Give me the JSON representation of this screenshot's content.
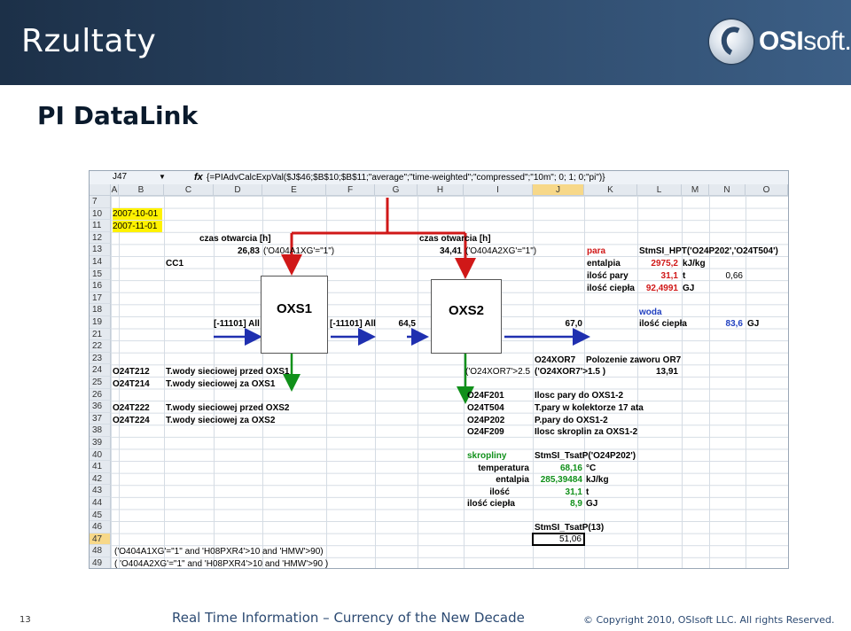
{
  "header": {
    "title": "Rzultaty",
    "logo_text_bold": "OSI",
    "logo_text_thin": "soft",
    "logo_reg": "."
  },
  "subtitle": "PI DataLink",
  "sheet": {
    "name_box": "J47",
    "fx": "fx",
    "formula": "{=PIAdvCalcExpVal($J$46;$B$10;$B$11;\"average\";\"time-weighted\";\"compressed\";\"10m\"; 0; 1; 0;\"pi\")}",
    "columns": [
      "A",
      "B",
      "C",
      "D",
      "E",
      "F",
      "G",
      "H",
      "I",
      "J",
      "K",
      "L",
      "M",
      "N",
      "O"
    ],
    "rows": [
      "7",
      "10",
      "11",
      "12",
      "13",
      "14",
      "15",
      "16",
      "17",
      "18",
      "19",
      "21",
      "22",
      "23",
      "24",
      "25",
      "26",
      "36",
      "37",
      "38",
      "39",
      "40",
      "41",
      "42",
      "43",
      "44",
      "45",
      "46",
      "47",
      "48",
      "49"
    ],
    "cells": {
      "b10": "2007-10-01",
      "b11": "2007-11-01",
      "czas1": "czas otwarcia [h]",
      "czas1_val": "26,83",
      "czas1_expr": "('O404A1XG'=\"1\")",
      "czas2": "czas otwarcia [h]",
      "czas2_val": "34,41",
      "czas2_expr": "('O404A2XG'=\"1\")",
      "cc1": "CC1",
      "para": "para",
      "stmsi_hpt": "StmSI_HPT('O24P202','O24T504')",
      "entalpia": "entalpia",
      "entalpia_val": "2975,2",
      "entalpia_unit": "kJ/kg",
      "ilosc_pary": "ilość pary",
      "ilosc_pary_val": "31,1",
      "ilosc_pary_unit": "t",
      "n15": "0,66",
      "ilosc_ciepla": "ilość ciepła",
      "ilosc_ciepla_val": "92,4991",
      "ilosc_ciepla_unit": "GJ",
      "woda": "woda",
      "ilosc_ciepla2": "ilość ciepła",
      "ilosc_ciepla2_val": "83,6",
      "ilosc_ciepla2_unit": "GJ",
      "all1": "[-11101] All",
      "all2": "[-11101] All",
      "h19": "64,5",
      "j19": "67,0",
      "box1": "OXS1",
      "box2": "OXS2",
      "o24xor7": "O24XOR7",
      "polozenie": "Polozenie zaworu OR7",
      "i24": "('O24XOR7'>2.5",
      "j24": "('O24XOR7'>1.5  )",
      "l24": "13,91",
      "r24_tag": "O24T212",
      "r24_desc": "T.wody sieciowej przed  OXS1",
      "r25_tag": "O24T214",
      "r25_desc": "T.wody sieciowej za OXS1",
      "r36_tag": "O24T222",
      "r36_desc": "T.wody sieciowej przed OXS2",
      "r37_tag": "O24T224",
      "r37_desc": "T.wody sieciowej za OXS2",
      "i26": "O24F201",
      "j26": "Ilosc pary do OXS1-2",
      "i36": "O24T504",
      "j36": "T.pary w kolektorze 17 ata",
      "i37": "O24P202",
      "j37": "P.pary do OXS1-2",
      "i38": "O24F209",
      "j38": "Ilosc skroplin za OXS1-2",
      "skropliny": "skropliny",
      "stmsi_tsat1": "StmSI_TsatP('O24P202')",
      "temperatura": "temperatura",
      "temperatura_val": "68,16",
      "temperatura_unit": "°C",
      "entalpia2": "entalpia",
      "entalpia2_val": "285,39484",
      "entalpia2_unit": "kJ/kg",
      "ilosc": "ilość",
      "ilosc_val": "31,1",
      "ilosc_unit": "t",
      "ilosc_ciepla3": "ilość ciepła",
      "ilosc_ciepla3_val": "8,9",
      "ilosc_ciepla3_unit": "GJ",
      "stmsi_tsat2": "StmSI_TsatP(13)",
      "j47": "51,06",
      "b48": "('O404A1XG'=\"1\"  and 'H08PXR4'>10 and 'HMW'>90)",
      "b49": "( 'O404A2XG'=\"1\"  and 'H08PXR4'>10 and 'HMW'>90 )"
    }
  },
  "footer": {
    "page_number": "13",
    "tagline": "Real Time Information – Currency of the New Decade",
    "copyright": "© Copyright 2010, OSIsoft LLC.  All rights Reserved."
  },
  "colors": {
    "header_bg": "#2e4a6b",
    "red_arrow": "#d01818",
    "blue_arrow": "#2030b0",
    "green_arrow": "#10901a",
    "highlight": "#fff200"
  }
}
